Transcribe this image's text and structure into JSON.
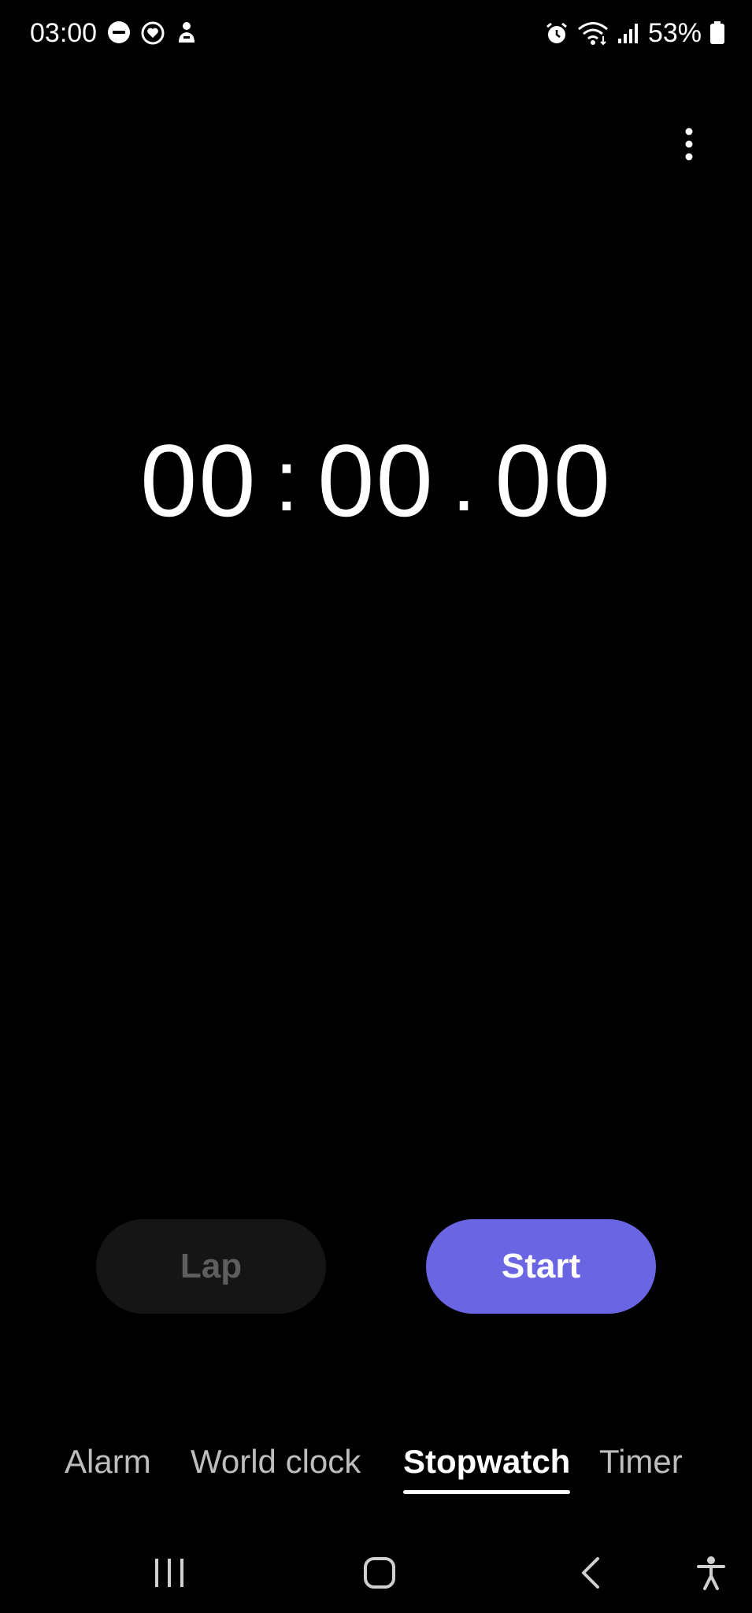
{
  "status_bar": {
    "time": "03:00",
    "battery_percent": "53%",
    "left_icons": [
      "do-not-disturb-icon",
      "heart-badge-icon",
      "person-notification-icon"
    ],
    "right_icons": [
      "alarm-icon",
      "wifi-icon",
      "signal-icon",
      "battery-icon"
    ]
  },
  "header": {
    "more_options_icon": "more-vertical-icon"
  },
  "stopwatch": {
    "minutes": "00",
    "seconds": "00",
    "hundredths": "00",
    "sep1": ":",
    "sep2": "."
  },
  "buttons": {
    "lap_label": "Lap",
    "start_label": "Start"
  },
  "tabs": [
    {
      "label": "Alarm",
      "active": false
    },
    {
      "label": "World clock",
      "active": false
    },
    {
      "label": "Stopwatch",
      "active": true
    },
    {
      "label": "Timer",
      "active": false
    }
  ],
  "colors": {
    "accent": "#6a66e3",
    "background": "#000000",
    "lap_button_bg": "#151515",
    "inactive_tab_text": "#bdbdbd"
  },
  "nav_bar": {
    "icons": [
      "recent-apps-icon",
      "home-icon",
      "back-icon",
      "accessibility-icon"
    ]
  }
}
